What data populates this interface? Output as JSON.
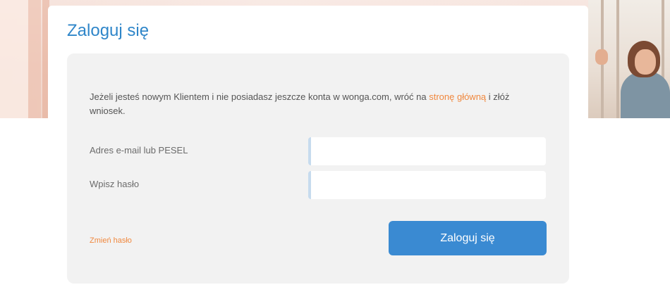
{
  "login": {
    "title": "Zaloguj się",
    "intro_before": "Jeżeli jesteś nowym Klientem i nie posiadasz jeszcze konta w wonga.com, wróć na ",
    "intro_link": "stronę główną",
    "intro_after": " i złóż wniosek.",
    "email_label": "Adres e-mail lub PESEL",
    "email_value": "",
    "password_label": "Wpisz hasło",
    "password_value": "",
    "forgot_link": "Zmień hasło",
    "submit_label": "Zaloguj się"
  },
  "colors": {
    "accent_blue": "#3a8ad2",
    "title_blue": "#2f86c9",
    "link_orange": "#f0883e",
    "panel_bg": "#f2f2f2"
  }
}
